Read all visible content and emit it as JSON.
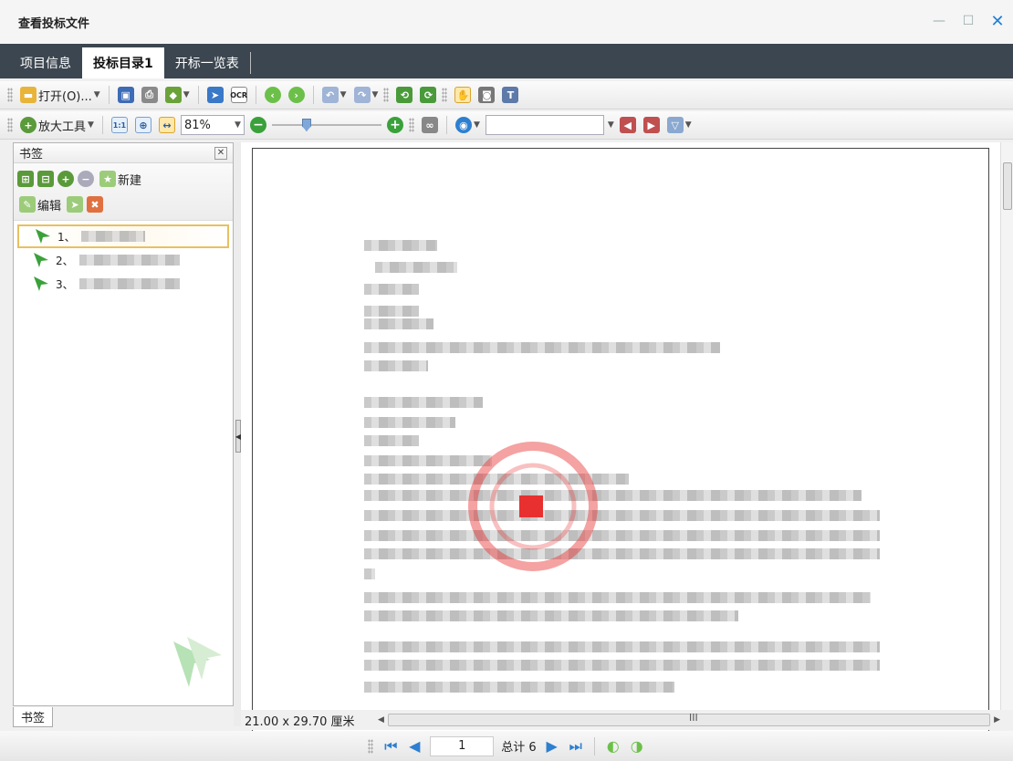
{
  "window": {
    "title": "查看投标文件"
  },
  "tabs": [
    {
      "label": "项目信息"
    },
    {
      "label": "投标目录1"
    },
    {
      "label": "开标一览表"
    }
  ],
  "toolbar1": {
    "open_label": "打开(O)..."
  },
  "toolbar2": {
    "zoom_tool_label": "放大工具",
    "zoom_value": "81%",
    "zoom_level": 0.3
  },
  "bookmarks": {
    "title": "书签",
    "new_label": "新建",
    "edit_label": "编辑",
    "items": [
      {
        "label": "1、"
      },
      {
        "label": "2、"
      },
      {
        "label": "3、"
      }
    ],
    "bottom_tab": "书签"
  },
  "status": {
    "page_size": "21.00 x 29.70 厘米",
    "scroll_mark": "III"
  },
  "nav": {
    "current_page": "1",
    "total_label": "总计 6"
  },
  "colors": {
    "tab_bar": "#3c4650",
    "close_accent": "#1e7fd8",
    "bookmark_green": "#3aa13a",
    "stamp_red": "#e83030"
  }
}
